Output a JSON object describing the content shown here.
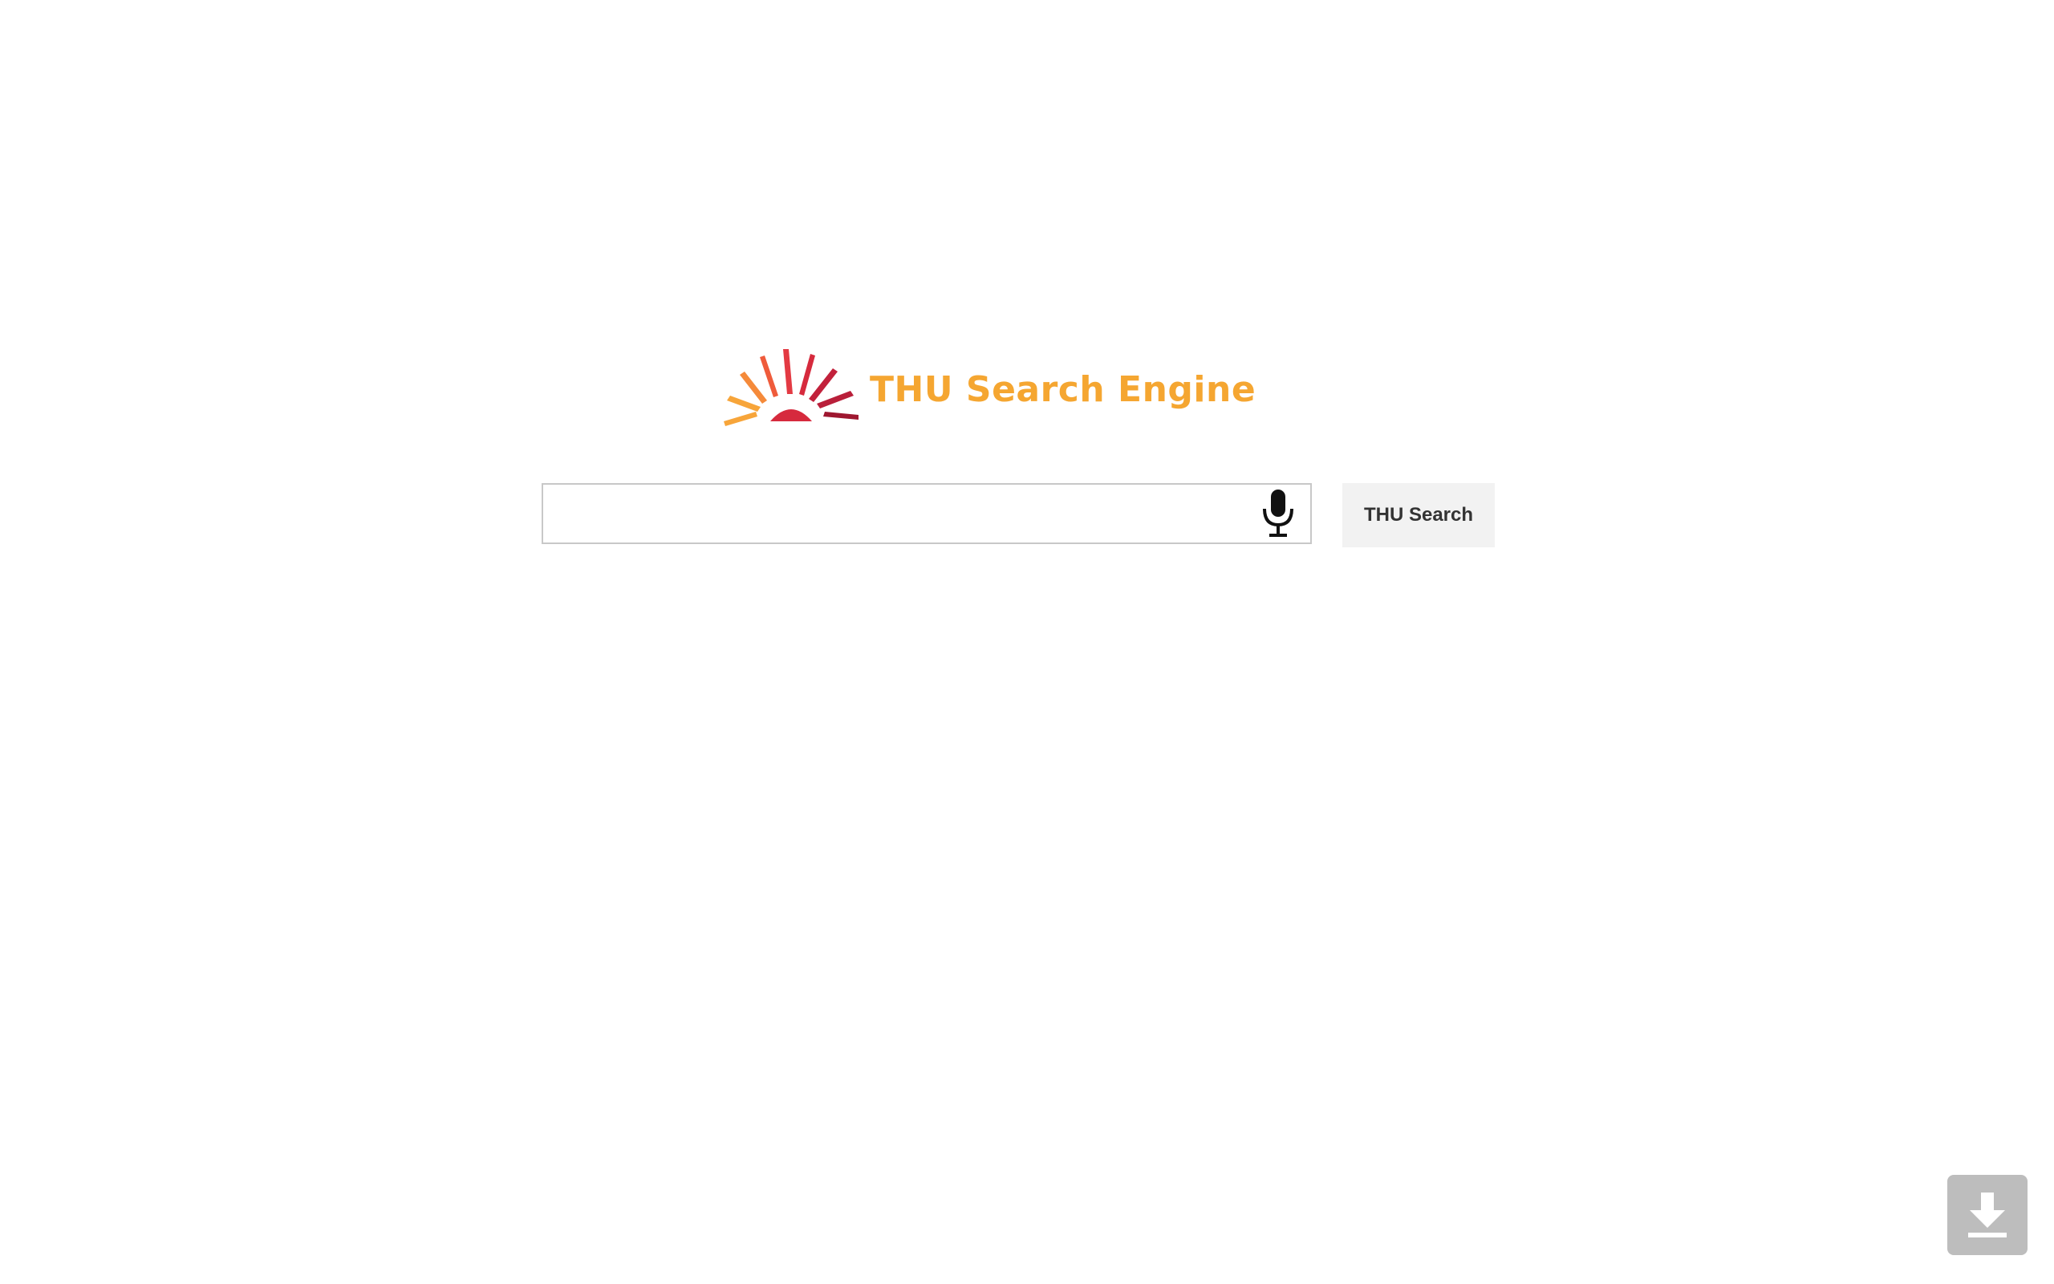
{
  "logo": {
    "text": "THU Search Engine",
    "colors": {
      "text": "#f5a631",
      "rays": [
        "#f7a53a",
        "#f58a3a",
        "#ef5b3b",
        "#e33a43",
        "#d62a3d",
        "#b91f3a",
        "#9e1730"
      ]
    }
  },
  "search": {
    "input_value": "",
    "placeholder": "",
    "mic_icon": "microphone-icon",
    "button_label": "THU Search"
  },
  "download": {
    "icon": "download-icon",
    "color": "#bdbdbd"
  }
}
